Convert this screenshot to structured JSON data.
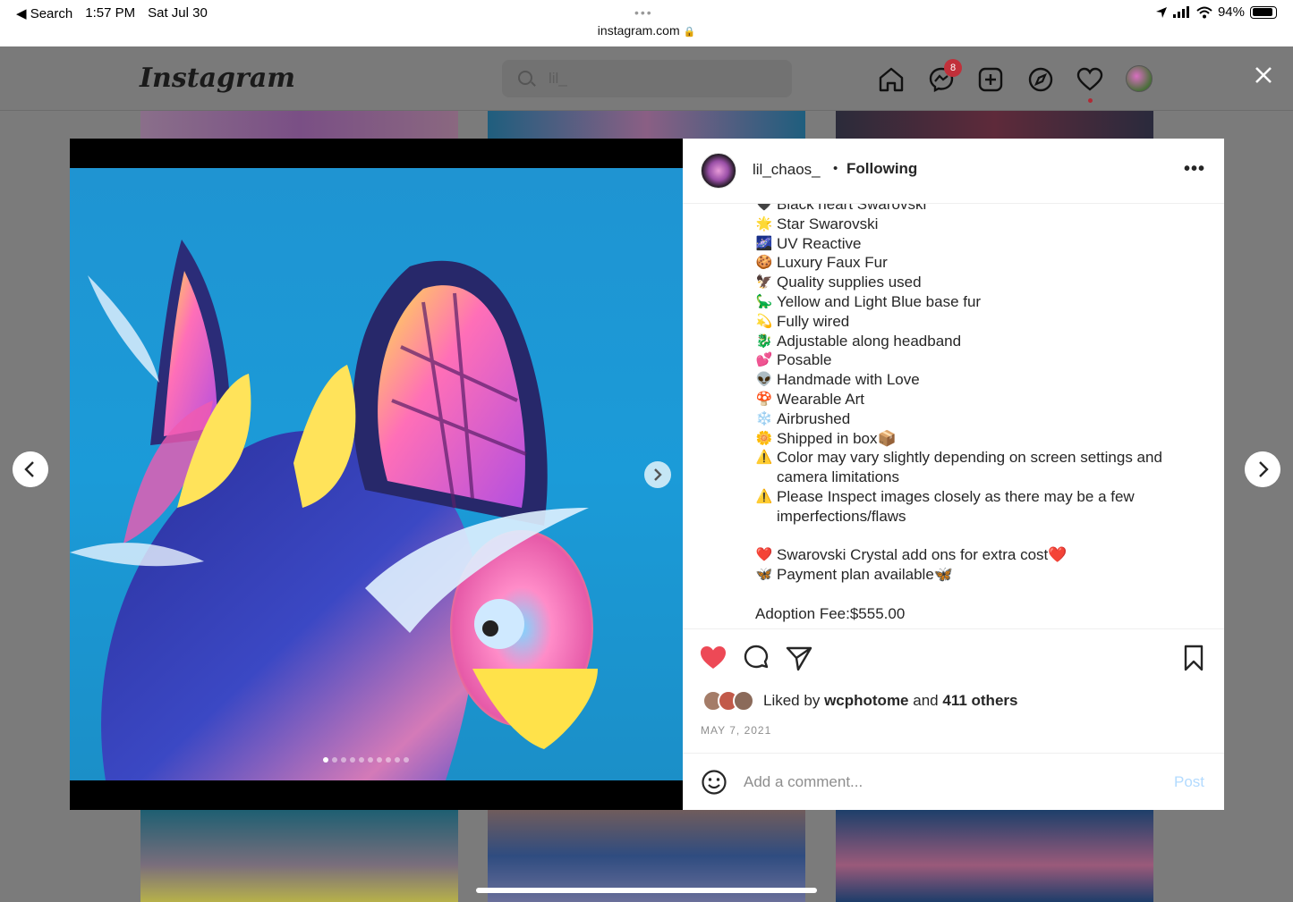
{
  "status_bar": {
    "back_label": "◀ Search",
    "time": "1:57 PM",
    "date": "Sat Jul 30",
    "battery": "94%",
    "url": "instagram.com"
  },
  "header": {
    "logo": "Instagram",
    "search_value": "lil_",
    "messages_badge": "8"
  },
  "post": {
    "username": "lil_chaos_",
    "separator": "•",
    "follow_status": "Following",
    "more": "•••",
    "caption_lines": [
      {
        "emoji": "🖤",
        "text": "Black heart Swarovski"
      },
      {
        "emoji": "🌟",
        "text": "Star Swarovski"
      },
      {
        "emoji": "🌌",
        "text": "UV Reactive"
      },
      {
        "emoji": "🍪",
        "text": "Luxury Faux Fur"
      },
      {
        "emoji": "🦅",
        "text": "Quality supplies used"
      },
      {
        "emoji": "🦕",
        "text": "Yellow and Light Blue base fur"
      },
      {
        "emoji": "💫",
        "text": "Fully wired"
      },
      {
        "emoji": "🐉",
        "text": "Adjustable along headband"
      },
      {
        "emoji": "💕",
        "text": "Posable"
      },
      {
        "emoji": "👽",
        "text": "Handmade with Love"
      },
      {
        "emoji": "🍄",
        "text": "Wearable Art"
      },
      {
        "emoji": "❄️",
        "text": "Airbrushed"
      },
      {
        "emoji": "🌼",
        "text": "Shipped in box📦"
      },
      {
        "emoji": "⚠️",
        "text": "Color may vary slightly depending on screen settings and camera limitations"
      },
      {
        "emoji": "⚠️",
        "text": "Please Inspect images closely as there may be a few imperfections/flaws"
      },
      {
        "emoji": "",
        "text": ""
      },
      {
        "emoji": "❤️",
        "text": "Swarovski Crystal add ons for extra cost❤️"
      },
      {
        "emoji": "🦋",
        "text": "Payment plan available🦋"
      },
      {
        "emoji": "",
        "text": ""
      },
      {
        "emoji": "",
        "text": "Adoption Fee:$555.00"
      }
    ],
    "liked_prefix": "Liked by",
    "liked_user": "wcphotome",
    "liked_and": "and",
    "liked_others": "411 others",
    "date": "MAY 7, 2021",
    "comment_placeholder": "Add a comment...",
    "post_button": "Post",
    "carousel": {
      "count": 10,
      "current": 1
    }
  },
  "colors": {
    "like_red": "#ed4956",
    "post_disabled": "#b3dbff",
    "overlay": "#7b7b7b"
  },
  "icons": [
    "home-icon",
    "messenger-icon",
    "new-post-icon",
    "explore-icon",
    "activity-heart-icon",
    "close-icon",
    "heart-icon",
    "comment-icon",
    "share-icon",
    "bookmark-icon",
    "emoji-icon",
    "chevron-left-icon",
    "chevron-right-icon"
  ]
}
